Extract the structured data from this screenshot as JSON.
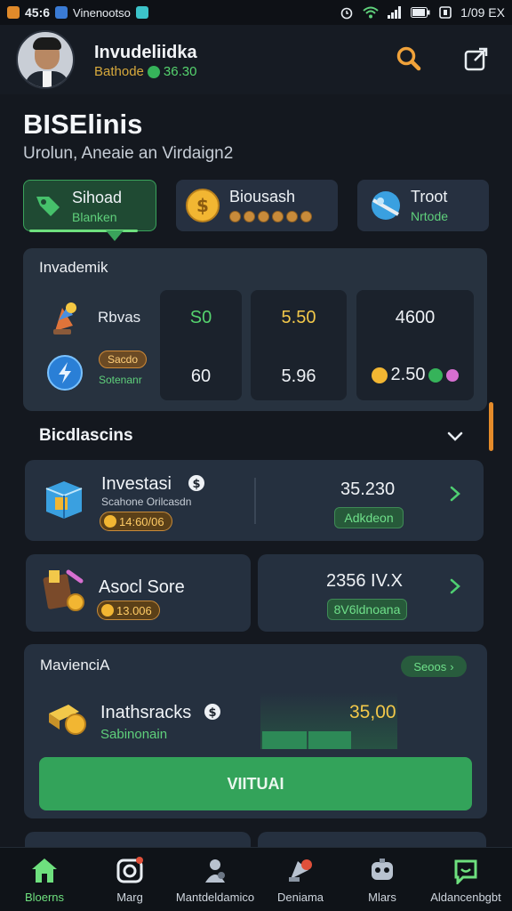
{
  "status_bar": {
    "time": "45:6",
    "carrier": "Vinenootso",
    "right_text": "1/09 EX"
  },
  "header": {
    "username": "Invudeliidka",
    "subline_label": "Bathode",
    "balance": "36.30"
  },
  "page": {
    "title": "BISElinis",
    "subtitle": "Urolun, Aneaie an Virdaign2"
  },
  "chips": [
    {
      "title": "Sihoad",
      "sub": "Blanken"
    },
    {
      "title": "Biousash",
      "sub": ""
    },
    {
      "title": "Troot",
      "sub": "Nrtode"
    }
  ],
  "investment_panel": {
    "title": "Invademik",
    "row1_label": "Rbvas",
    "pill_label": "Sacdo",
    "sub_label": "Sotenanr",
    "cells": [
      {
        "top": "S0",
        "bottom": "60"
      },
      {
        "top": "5.50",
        "bottom": "5.96"
      },
      {
        "top": "4600",
        "bottom": "2.50"
      }
    ]
  },
  "section": {
    "title": "Bicdlascins"
  },
  "card_investasi": {
    "title": "Investasi",
    "sub": "Scahone Orilcasdn",
    "tag": "14:60/06",
    "value": "35.230",
    "action": "Adkdeon"
  },
  "card_asset": {
    "title": "Asocl Sore",
    "tag": "13.006",
    "value": "2356 IV.X",
    "action": "8V6ldnoana"
  },
  "card_maviencia": {
    "title": "MavienciA",
    "see_all": "Seoos",
    "item_title": "Inathsracks",
    "item_sub": "Sabinonain",
    "value": "35,00",
    "button": "VIITUAI"
  },
  "bottom_nav": [
    {
      "label": "Bloerns",
      "icon": "home-icon"
    },
    {
      "label": "Marg",
      "icon": "camera-icon"
    },
    {
      "label": "Mantdeldamico",
      "icon": "profile-icon"
    },
    {
      "label": "Deniama",
      "icon": "wallet-icon"
    },
    {
      "label": "Mlars",
      "icon": "robot-icon"
    },
    {
      "label": "Aldancenbgbt",
      "icon": "chat-icon"
    }
  ],
  "colors": {
    "accent_green": "#33a35a",
    "accent_orange": "#d7a93c",
    "background": "#14181f",
    "panel": "#25303f"
  }
}
